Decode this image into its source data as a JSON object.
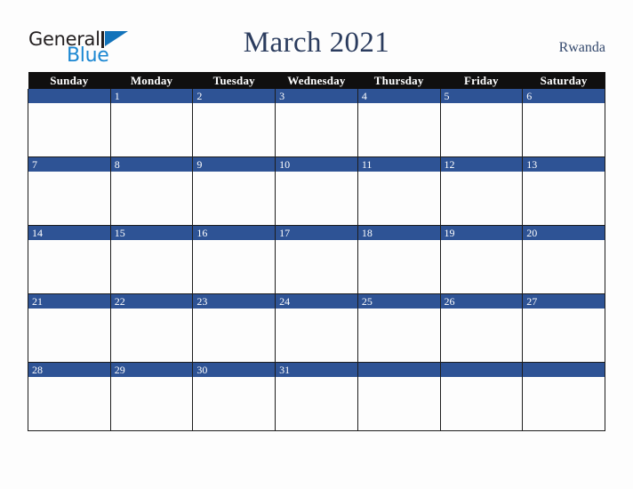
{
  "logo": {
    "text_primary": "General",
    "text_secondary": "Blue",
    "mark": "blue-triangle",
    "color_primary": "#231f20",
    "color_secondary": "#1b87d2",
    "color_mark": "#1273ba"
  },
  "header": {
    "title": "March 2021",
    "country": "Rwanda",
    "title_color": "#2b3c5e",
    "country_color": "#33486d"
  },
  "calendar": {
    "weekday_headers": [
      "Sunday",
      "Monday",
      "Tuesday",
      "Wednesday",
      "Thursday",
      "Friday",
      "Saturday"
    ],
    "header_bg": "#100f0f",
    "header_fg": "#ffffff",
    "date_bar_bg": "#2e5395",
    "date_bar_fg": "#ffffff",
    "cell_bg": "#fdfdfd",
    "border_color": "#1d1d1d",
    "weeks": [
      [
        "",
        "1",
        "2",
        "3",
        "4",
        "5",
        "6"
      ],
      [
        "7",
        "8",
        "9",
        "10",
        "11",
        "12",
        "13"
      ],
      [
        "14",
        "15",
        "16",
        "17",
        "18",
        "19",
        "20"
      ],
      [
        "21",
        "22",
        "23",
        "24",
        "25",
        "26",
        "27"
      ],
      [
        "28",
        "29",
        "30",
        "31",
        "",
        "",
        ""
      ]
    ]
  }
}
